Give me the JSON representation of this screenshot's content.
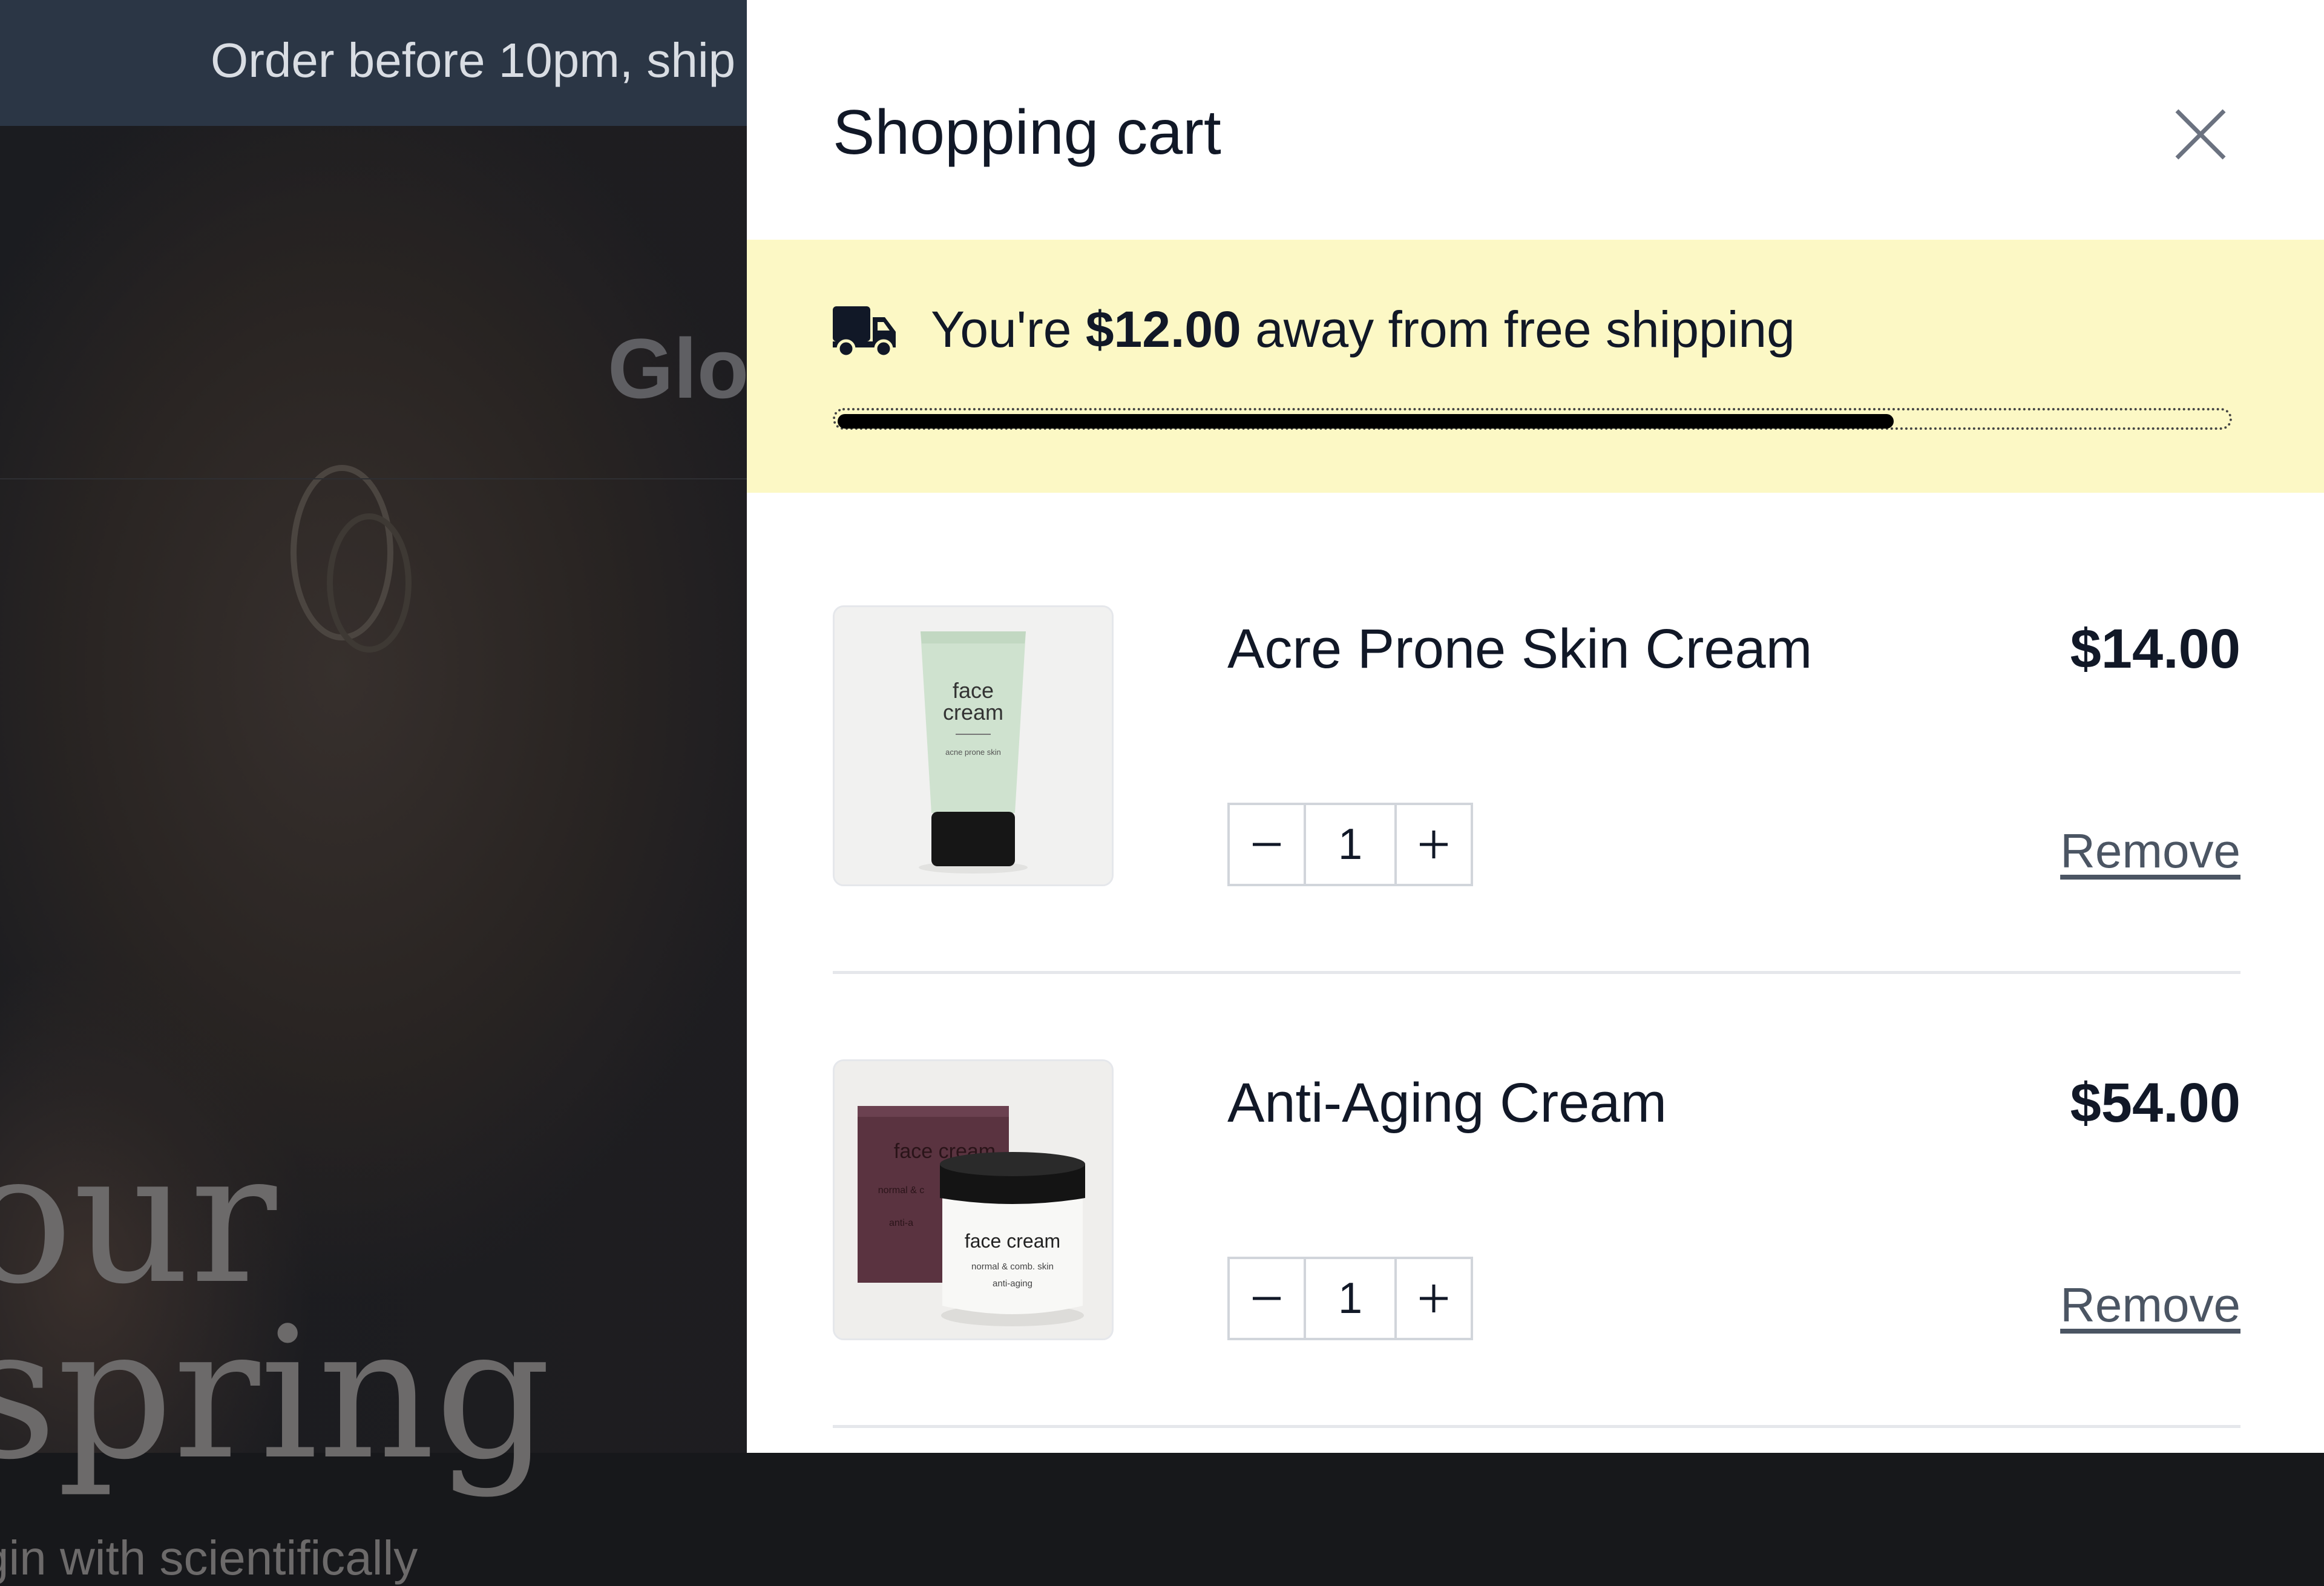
{
  "announcement": {
    "text": "Order before 10pm, ship"
  },
  "hero": {
    "logo": "Glo",
    "title": "our\nspring",
    "subtitle": "gin with scientifically"
  },
  "cart": {
    "title": "Shopping cart",
    "shipping": {
      "prefix": "You're ",
      "amount": "$12.00",
      "suffix": " away from free shipping",
      "progress_fraction": 0.76
    },
    "items": [
      {
        "name": "Acre Prone Skin Cream",
        "price": "$14.00",
        "quantity": "1",
        "remove_label": "Remove",
        "image": {
          "line1": "face",
          "line2": "cream",
          "caption": "acne prone skin"
        }
      },
      {
        "name": "Anti-Aging Cream",
        "price": "$54.00",
        "quantity": "1",
        "remove_label": "Remove",
        "image": {
          "box_label": "face cream",
          "box_sub": "normal & c",
          "box_sub2": "anti-a",
          "jar_label": "face cream",
          "jar_sub1": "normal & comb. skin",
          "jar_sub2": "anti-aging"
        }
      }
    ]
  },
  "colors": {
    "overlay": "#17181b",
    "announcement_bg": "#2b3645",
    "shipping_banner_bg": "#fcf8c5",
    "text": "#111827",
    "progress_fill": "#000000"
  }
}
